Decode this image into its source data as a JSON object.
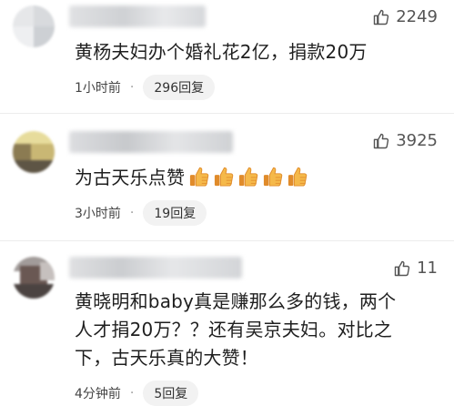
{
  "comments": [
    {
      "likes": "2249",
      "text": "黄杨夫妇办个婚礼花2亿，捐款20万",
      "time": "1小时前",
      "separator": "·",
      "replies": "296回复",
      "avatar_colors": [
        "#e8e8ea",
        "#dcdde0",
        "#f0f0f2",
        "#cfd2d6"
      ]
    },
    {
      "likes": "3925",
      "text": "为古天乐点赞",
      "emoji": [
        "thumbs-up-emoji",
        "thumbs-up-emoji",
        "thumbs-up-emoji",
        "thumbs-up-emoji",
        "thumbs-up-emoji"
      ],
      "time": "3小时前",
      "separator": "·",
      "replies": "19回复",
      "avatar_colors": [
        "#d9c77a",
        "#8a7a55",
        "#e9dca0",
        "#5c5444"
      ]
    },
    {
      "likes": "11",
      "text_lines": [
        "黄晓明和baby真是赚那么多的钱，两个",
        "人才捐20万？？还有吴京夫妇。对比之",
        "下，古天乐真的大赞！"
      ],
      "time": "4分钟前",
      "separator": "·",
      "replies": "5回复",
      "avatar_colors": [
        "#6b5a55",
        "#a09a98",
        "#4a4240",
        "#c8c2c0"
      ]
    }
  ],
  "colors": {
    "thumb_emoji_fill": "#f5b94a",
    "thumb_emoji_shadow": "#e08b2b",
    "thumb_outline": "#555555",
    "reply_pill_bg": "#f2f2f2"
  }
}
